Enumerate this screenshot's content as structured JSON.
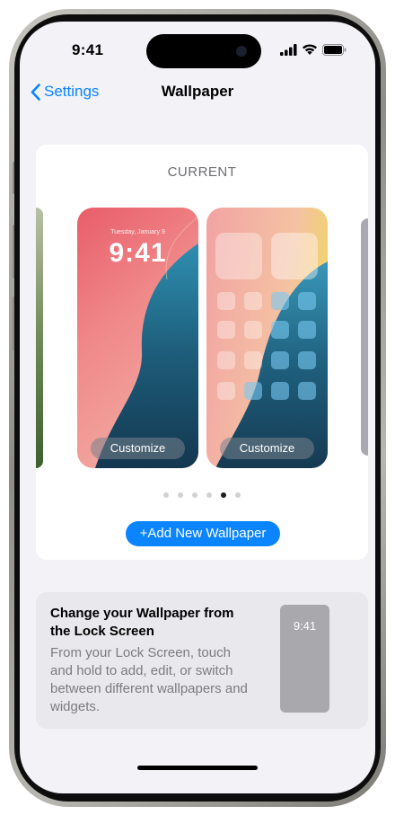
{
  "status_bar": {
    "time": "9:41"
  },
  "nav": {
    "back_label": "Settings",
    "title": "Wallpaper"
  },
  "carousel": {
    "section_label": "CURRENT",
    "lock_screen": {
      "date": "Tuesday, January 9",
      "time": "9:41",
      "customize_label": "Customize"
    },
    "home_screen": {
      "customize_label": "Customize"
    },
    "page_count": 6,
    "active_page": 5
  },
  "add_button_label": "+Add New Wallpaper",
  "tip": {
    "title": "Change your Wallpaper from the Lock Screen",
    "body": "From your Lock Screen, touch and hold to add, edit, or switch between different wallpapers and widgets.",
    "preview_time": "9:41"
  },
  "colors": {
    "accent": "#0a84ff",
    "background": "#f2f2f7"
  }
}
